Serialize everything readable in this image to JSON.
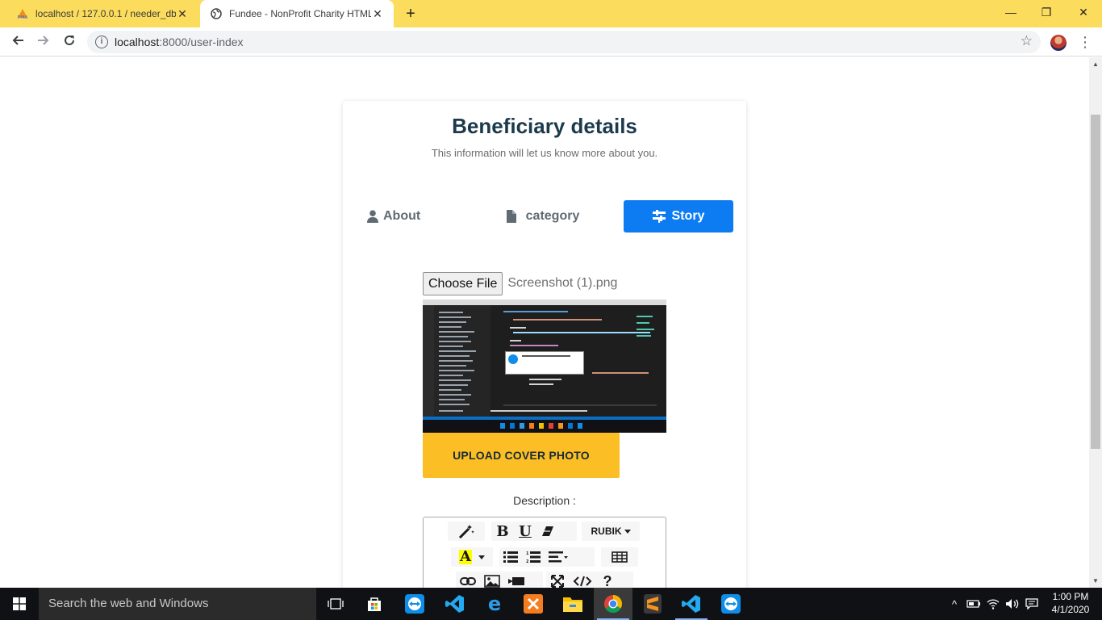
{
  "browser": {
    "tabs": [
      {
        "title": "localhost / 127.0.0.1 / needer_db",
        "favicon": "PMA",
        "active": false
      },
      {
        "title": "Fundee - NonProfit Charity HTML",
        "favicon": "globe-icon",
        "active": true
      }
    ],
    "url_host": "localhost",
    "url_path": ":8000/user-index",
    "window_controls": {
      "minimize": "—",
      "restore": "❐",
      "close": "✕"
    }
  },
  "page": {
    "title": "Beneficiary details",
    "subtitle": "This information will let us know more about you.",
    "steps": [
      {
        "label": "About",
        "icon": "user-icon",
        "active": false
      },
      {
        "label": "category",
        "icon": "file-icon",
        "active": false
      },
      {
        "label": "Story",
        "icon": "sliders-icon",
        "active": true
      }
    ],
    "file_input": {
      "button_label": "Choose File",
      "file_name": "Screenshot (1).png"
    },
    "upload_button": "UPLOAD COVER PHOTO",
    "description_label": "Description :",
    "editor": {
      "font_dropdown": "RUBIK",
      "toolbar_icons": [
        "magic-icon",
        "bold-icon",
        "underline-icon",
        "eraser-icon",
        "font-dropdown",
        "text-color-icon",
        "unordered-list-icon",
        "ordered-list-icon",
        "align-icon",
        "table-icon",
        "link-icon",
        "picture-icon",
        "video-icon",
        "fullscreen-icon",
        "code-view-icon",
        "help-icon"
      ]
    }
  },
  "taskbar": {
    "search_placeholder": "Search the web and Windows",
    "apps": [
      "task-view-icon",
      "store-icon",
      "teamviewer-icon",
      "vscode-icon",
      "edge-icon",
      "xampp-icon",
      "file-explorer-icon",
      "chrome-icon",
      "sublime-icon",
      "vscode-icon",
      "teamviewer-icon"
    ],
    "time": "1:00 PM",
    "date": "4/1/2020"
  },
  "colors": {
    "tabbar": "#fbdc5c",
    "primary": "#0d7bf2",
    "upload_button": "#fbbf25",
    "heading": "#1b3a4b"
  }
}
